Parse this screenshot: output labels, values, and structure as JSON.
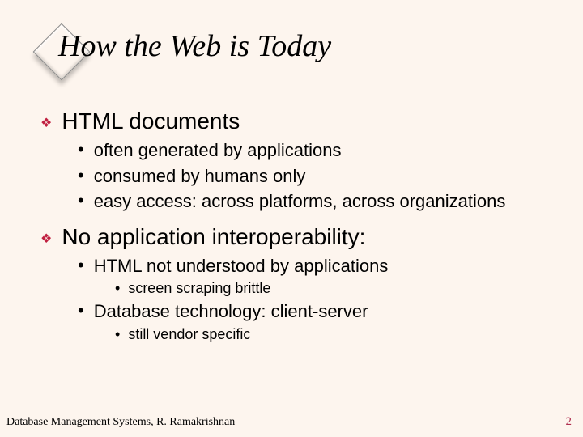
{
  "title": "How the Web is Today",
  "points": {
    "p1": {
      "label": "HTML documents",
      "subs": {
        "s1": "often generated by applications",
        "s2": "consumed by humans only",
        "s3": "easy access: across platforms, across organizations"
      }
    },
    "p2": {
      "label": "No application interoperability:",
      "subs": {
        "s1": "HTML not understood by applications",
        "s1subs": {
          "a": "screen scraping brittle"
        },
        "s2": "Database technology: client-server",
        "s2subs": {
          "a": "still vendor specific"
        }
      }
    }
  },
  "footer": {
    "left": "Database Management Systems, R. Ramakrishnan",
    "right": "2"
  }
}
